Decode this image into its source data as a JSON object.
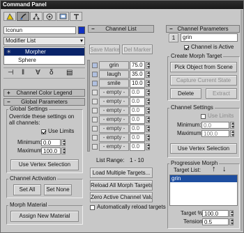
{
  "window_title": "Command Panel",
  "object_name": "Iconun",
  "modifier_list": {
    "label": "Modifier List"
  },
  "stack": [
    {
      "label": "Morpher",
      "selected": true
    },
    {
      "label": "Sphere",
      "selected": false
    }
  ],
  "left": {
    "channel_color_legend": "Channel Color Legend",
    "global_parameters": "Global Parameters",
    "global_settings": "Global Settings",
    "override_text": "Override these settings on all channels:",
    "use_limits": "Use Limits",
    "minimum_label": "Minimum:",
    "minimum_value": "0.0",
    "maximum_label": "Maximum:",
    "maximum_value": "100.0",
    "use_vertex_selection": "Use Vertex Selection",
    "channel_activation": "Channel Activation",
    "set_all": "Set All",
    "set_none": "Set None",
    "morph_material": "Morph Material",
    "assign_new_material": "Assign New Material"
  },
  "middle": {
    "title": "Channel List",
    "save_marker": "Save Marker",
    "del_marker": "Del Marker",
    "channels": [
      {
        "name": "grin",
        "value": "75.0"
      },
      {
        "name": "laugh",
        "value": "35.0"
      },
      {
        "name": "smile",
        "value": "10.0"
      },
      {
        "name": "- empty -",
        "value": "0.0"
      },
      {
        "name": "- empty -",
        "value": "0.0"
      },
      {
        "name": "- empty -",
        "value": "0.0"
      },
      {
        "name": "- empty -",
        "value": "0.0"
      },
      {
        "name": "- empty -",
        "value": "0.0"
      },
      {
        "name": "- empty -",
        "value": "0.0"
      },
      {
        "name": "- empty -",
        "value": "0.0"
      }
    ],
    "list_range_label": "List Range:",
    "list_range_value": "1 - 10",
    "load_multiple_targets": "Load Multiple Targets...",
    "reload_all_morph_targets": "Reload All Morph Targets",
    "zero_active_channel_values": "Zero Active Channel Values",
    "automatically_reload_targets": "Automatically reload targets"
  },
  "right": {
    "title": "Channel Parameters",
    "channel_number": "1",
    "channel_name": "grin",
    "channel_is_active": "Channel is Active",
    "create_morph_target": "Create Morph Target",
    "pick_object_from_scene": "Pick Object from Scene",
    "capture_current_state": "Capture Current State",
    "delete": "Delete",
    "extract": "Extract",
    "channel_settings": "Channel Settings",
    "use_limits": "Use Limits",
    "minimum_label": "Minimum:",
    "minimum_value": "0.0",
    "maximum_label": "Maximum:",
    "maximum_value": "100.0",
    "use_vertex_selection": "Use Vertex Selection",
    "progressive_morph": "Progressive Morph",
    "target_list": "Target List:",
    "up_arrow": "↑",
    "down_arrow": "↓",
    "targets": [
      "grin"
    ],
    "target_pct_label": "Target %:",
    "target_pct_value": "100.0",
    "tension_label": "Tension:",
    "tension_value": "0.5"
  },
  "colors": {
    "selected": "#0a246a",
    "panel": "#c8c8c8",
    "titlebar": "#1a1a1a",
    "list_sel": "#1e4ea0"
  }
}
